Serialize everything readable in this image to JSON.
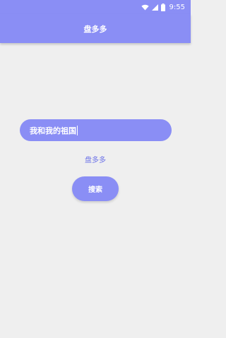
{
  "status_bar": {
    "time": "9:55",
    "icons": [
      "wifi-icon",
      "signal-icon",
      "battery-icon"
    ]
  },
  "app_bar": {
    "title": "盘多多"
  },
  "search": {
    "value": "我和我的祖国"
  },
  "sub_label": "盘多多",
  "search_button": {
    "label": "搜索"
  },
  "colors": {
    "accent": "#8a8ef5",
    "background": "#efefef",
    "label_text": "#6e74e8",
    "on_accent": "#ffffff"
  }
}
